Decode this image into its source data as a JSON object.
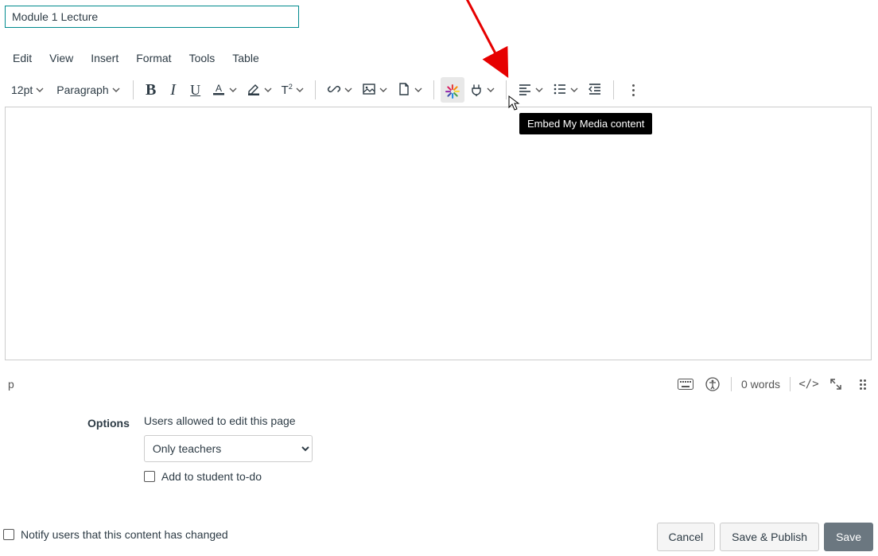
{
  "title_value": "Module 1 Lecture",
  "menubar": [
    "Edit",
    "View",
    "Insert",
    "Format",
    "Tools",
    "Table"
  ],
  "toolbar": {
    "font_size": "12pt",
    "block_format": "Paragraph"
  },
  "tooltip": "Embed My Media content",
  "status": {
    "path": "p",
    "word_count": "0 words"
  },
  "options": {
    "label": "Options",
    "allowed_label": "Users allowed to edit this page",
    "allowed_value": "Only teachers",
    "todo_label": "Add to student to-do"
  },
  "notify_label": "Notify users that this content has changed",
  "buttons": {
    "cancel": "Cancel",
    "save_publish": "Save & Publish",
    "save": "Save"
  }
}
